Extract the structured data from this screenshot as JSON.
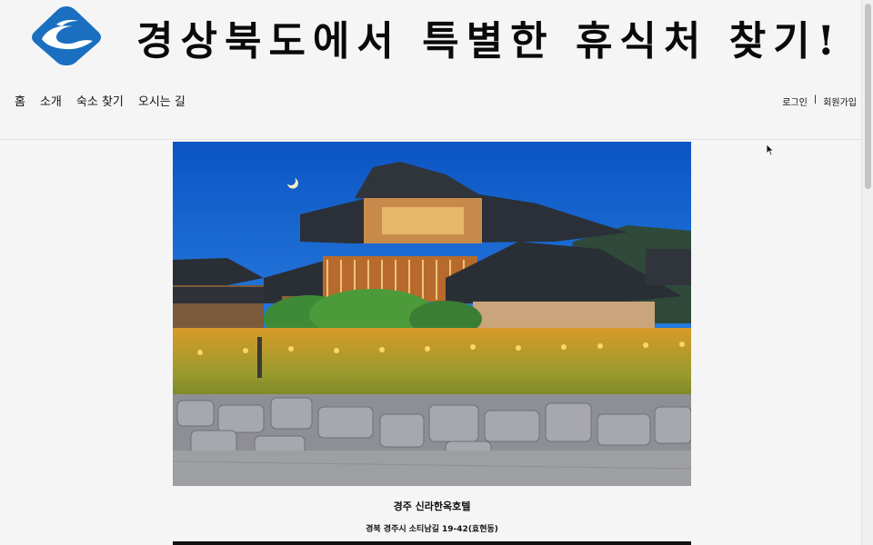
{
  "header": {
    "title": "경상북도에서 특별한 휴식처 찾기!",
    "logo_icon": "wave-diamond-logo-icon",
    "brand_color": "#1a6fc0"
  },
  "nav": {
    "items": [
      {
        "label": "홈"
      },
      {
        "label": "소개"
      },
      {
        "label": "숙소 찾기"
      },
      {
        "label": "오시는 길"
      }
    ]
  },
  "auth": {
    "login": "로그인",
    "separator": "|",
    "signup": "회원가입"
  },
  "listing": {
    "image_icon": "hanok-hotel-photo",
    "name": "경주 신라한옥호텔",
    "address": "경북 경주시 소티남길 19-42(효현동)"
  }
}
